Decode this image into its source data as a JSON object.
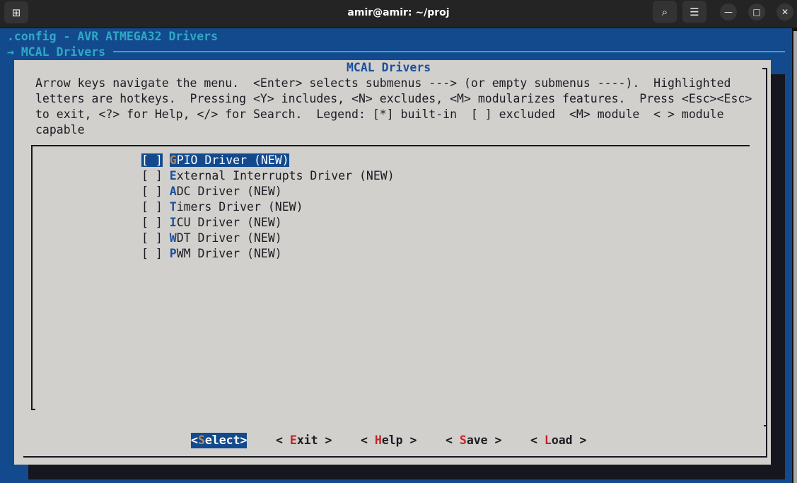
{
  "window": {
    "title": "amir@amir: ~/proj"
  },
  "header": {
    "config": ".config - AVR ATMEGA32 Drivers",
    "breadcrumb": "→ MCAL Drivers"
  },
  "dialog": {
    "title": "MCAL Drivers",
    "help": [
      "Arrow keys navigate the menu.  <Enter> selects submenus ---> (or empty submenus ----).  Highlighted",
      "letters are hotkeys.  Pressing <Y> includes, <N> excludes, <M> modularizes features.  Press <Esc><Esc>",
      "to exit, <?> for Help, </> for Search.  Legend: [*] built-in  [ ] excluded  <M> module  < > module",
      "capable"
    ]
  },
  "menu": [
    {
      "check": "[ ]",
      "hotkey": "G",
      "rest": "PIO Driver (NEW)",
      "selected": true
    },
    {
      "check": "[ ]",
      "hotkey": "E",
      "rest": "xternal Interrupts Driver (NEW)"
    },
    {
      "check": "[ ]",
      "hotkey": "A",
      "rest": "DC Driver (NEW)"
    },
    {
      "check": "[ ]",
      "hotkey": "T",
      "rest": "imers Driver (NEW)"
    },
    {
      "check": "[ ]",
      "hotkey": "I",
      "rest": "CU Driver (NEW)"
    },
    {
      "check": "[ ]",
      "hotkey": "W",
      "rest": "DT Driver (NEW)"
    },
    {
      "check": "[ ]",
      "hotkey": "P",
      "rest": "WM Driver (NEW)"
    }
  ],
  "buttons": [
    {
      "pre": "<",
      "key": "S",
      "rest": "elect>"
    },
    {
      "pre": "< ",
      "key": "E",
      "rest": "xit >"
    },
    {
      "pre": "< ",
      "key": "H",
      "rest": "elp >"
    },
    {
      "pre": "< ",
      "key": "S",
      "rest": "ave >"
    },
    {
      "pre": "< ",
      "key": "L",
      "rest": "oad >"
    }
  ]
}
